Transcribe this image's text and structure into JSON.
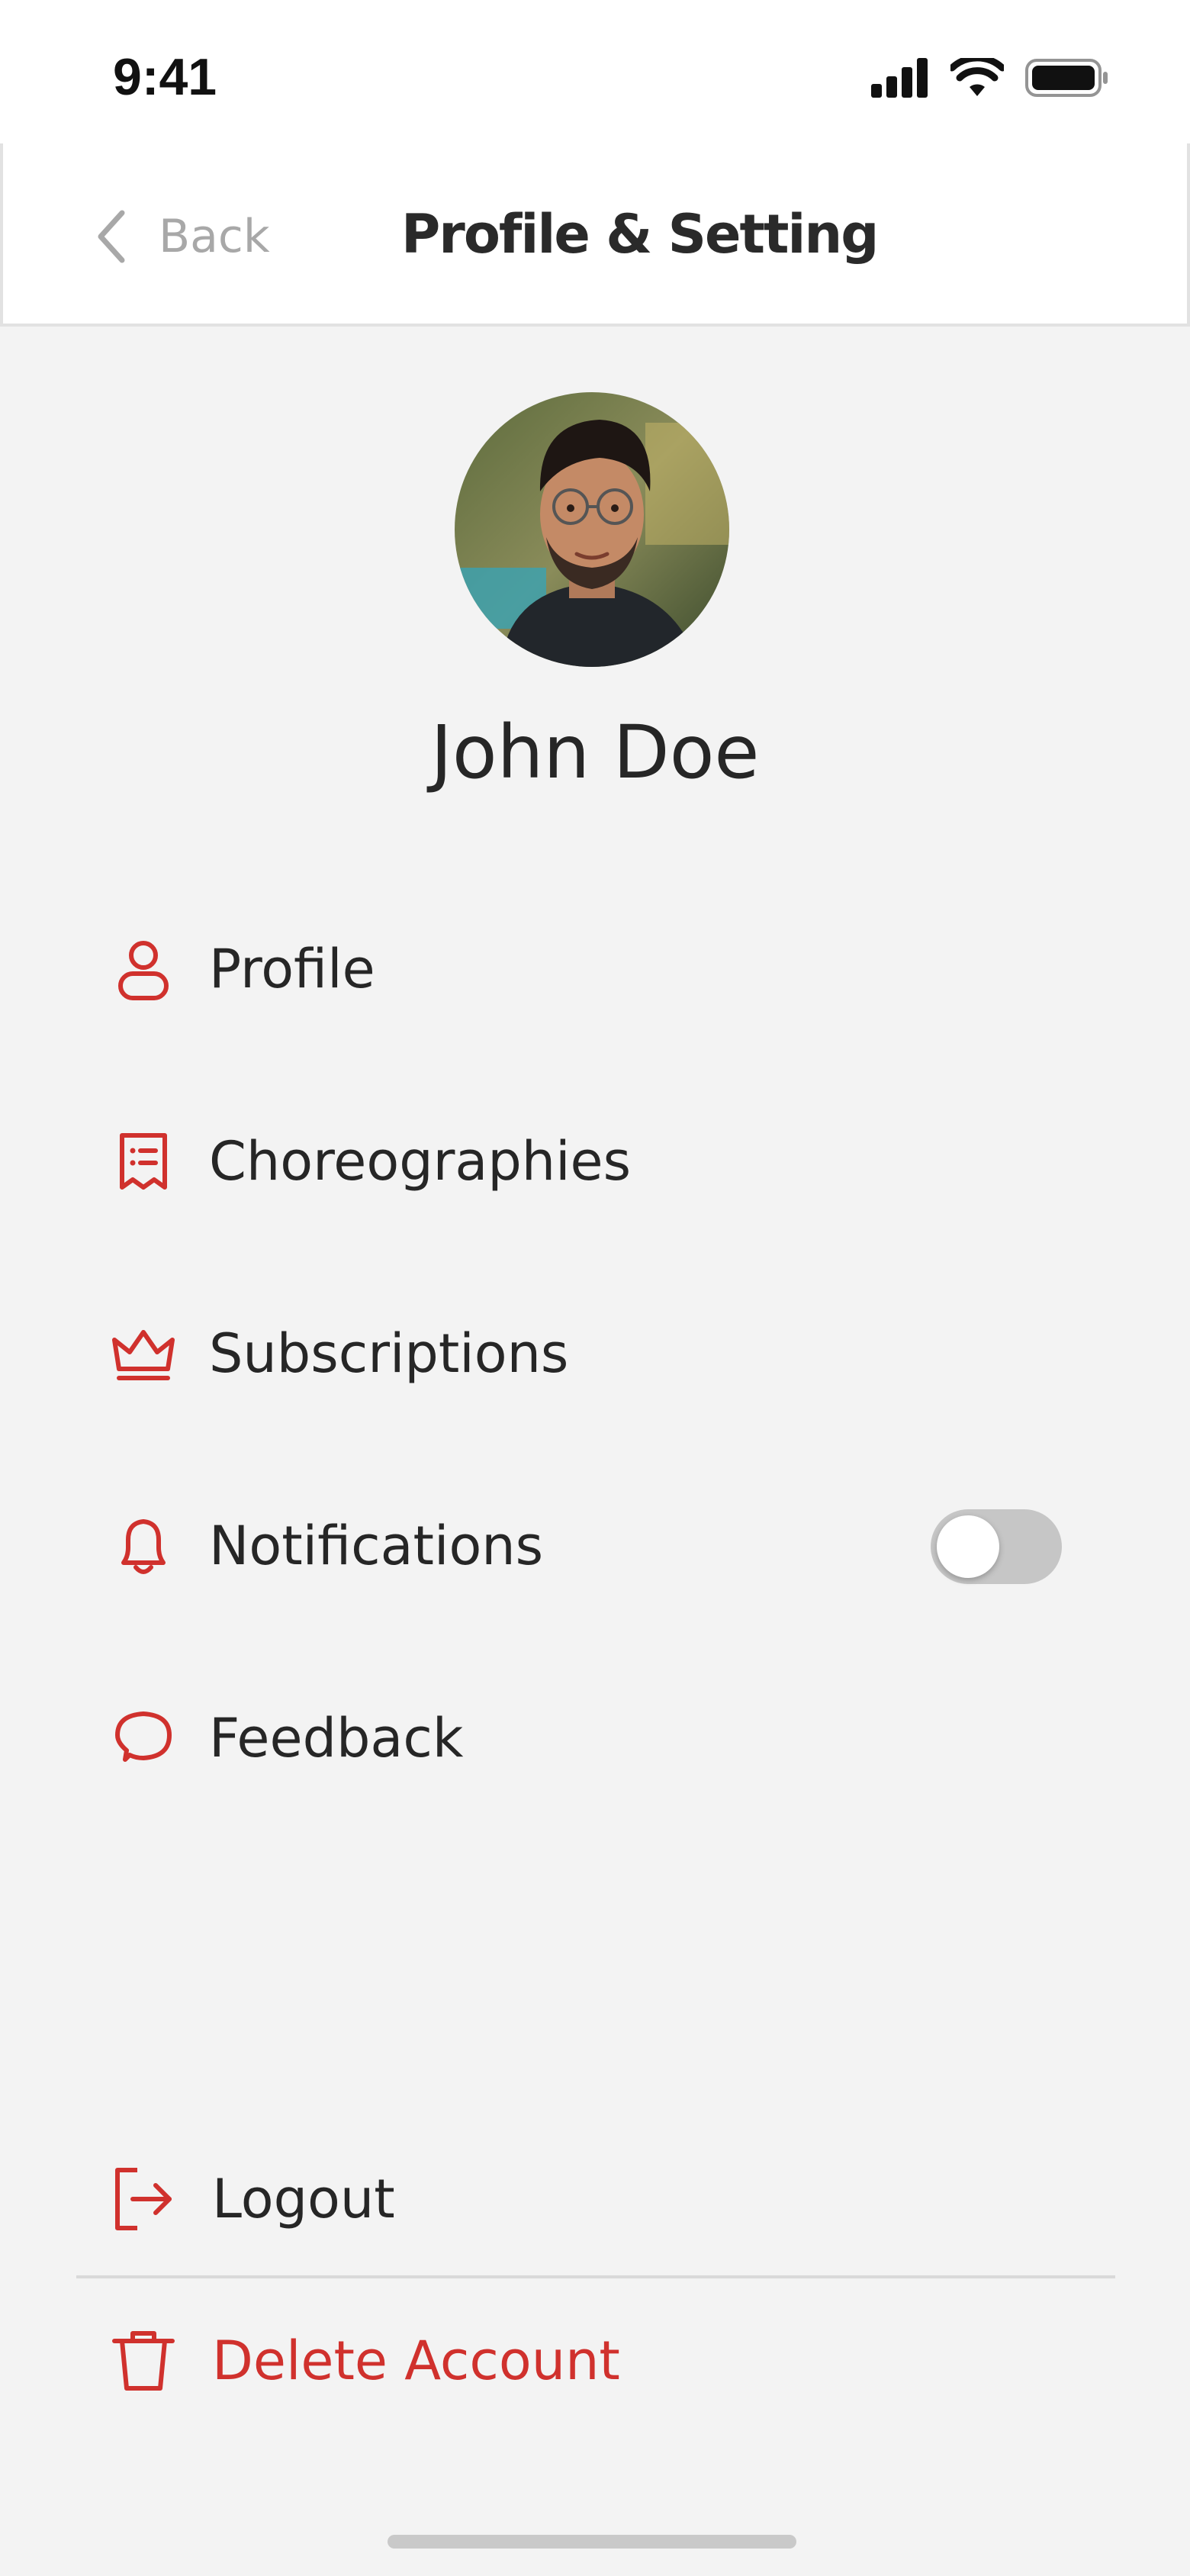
{
  "status_bar": {
    "time": "9:41",
    "icons": [
      "cellular-signal-icon",
      "wifi-icon",
      "battery-icon"
    ]
  },
  "header": {
    "back_label": "Back",
    "title": "Profile & Setting"
  },
  "profile": {
    "name": "John Doe"
  },
  "menu": {
    "items": [
      {
        "label": "Profile",
        "icon": "user-icon"
      },
      {
        "label": "Choreographies",
        "icon": "list-document-icon"
      },
      {
        "label": "Subscriptions",
        "icon": "crown-icon"
      },
      {
        "label": "Notifications",
        "icon": "bell-icon",
        "toggle_on": false
      },
      {
        "label": "Feedback",
        "icon": "chat-bubble-icon"
      }
    ]
  },
  "actions": {
    "logout_label": "Logout",
    "delete_label": "Delete Account"
  },
  "colors": {
    "accent": "#d0312d",
    "background": "#f3f3f3",
    "text": "#262626",
    "muted": "#a8a8a8"
  }
}
